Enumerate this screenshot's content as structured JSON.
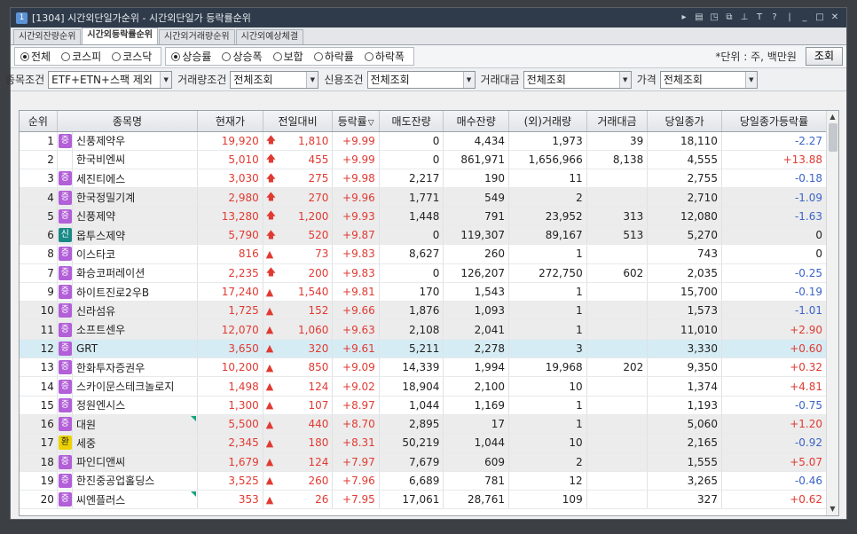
{
  "window": {
    "title": "[1304] 시간외단일가순위 - 시간외단일가 등락률순위",
    "icon_glyph": "1",
    "titlebar_icons": [
      "arrow-right-icon",
      "window-list-icon",
      "link-icon",
      "copy-icon",
      "pin-icon",
      "font-icon",
      "help-icon",
      "minimize-icon",
      "maximize-icon",
      "close-icon"
    ]
  },
  "tabs": [
    {
      "label": "시간외잔량순위",
      "active": false
    },
    {
      "label": "시간외등락률순위",
      "active": true
    },
    {
      "label": "시간외거래량순위",
      "active": false
    },
    {
      "label": "시간외예상체결",
      "active": false
    }
  ],
  "market_radios": [
    {
      "label": "전체",
      "selected": true
    },
    {
      "label": "코스피",
      "selected": false
    },
    {
      "label": "코스닥",
      "selected": false
    }
  ],
  "sort_radios": [
    {
      "label": "상승률",
      "selected": true
    },
    {
      "label": "상승폭",
      "selected": false
    },
    {
      "label": "보합",
      "selected": false
    },
    {
      "label": "하락률",
      "selected": false
    },
    {
      "label": "하락폭",
      "selected": false
    }
  ],
  "unit_text": "*단위 : 주, 백만원",
  "query_button": "조회",
  "filters": {
    "stock_cond_label": "종목조건",
    "stock_cond_value": "ETF+ETN+스팩 제외",
    "volume_cond_label": "거래량조건",
    "volume_cond_value": "전체조회",
    "credit_cond_label": "신용조건",
    "credit_cond_value": "전체조회",
    "amount_label": "거래대금",
    "amount_value": "전체조회",
    "price_label": "가격",
    "price_value": "전체조회"
  },
  "columns": [
    "순위",
    "종목명",
    "현재가",
    "전일대비",
    "등락률",
    "매도잔량",
    "매수잔량",
    "(외)거래량",
    "거래대금",
    "당일종가",
    "당일종가등락률"
  ],
  "sort_indicator": "▽",
  "rows": [
    {
      "rank": "1",
      "badge": "증",
      "badge_color": "#b25fd8",
      "name": "신풍제약우",
      "price": "19,920",
      "arrow": "🡅",
      "change": "1,810",
      "rate": "+9.99",
      "sell": "0",
      "buy": "4,434",
      "volume": "1,973",
      "amount": "39",
      "close": "18,110",
      "close_rate": "-2.27",
      "close_color": "blue",
      "shade": false,
      "hl": false,
      "tri": false
    },
    {
      "rank": "2",
      "badge": "",
      "badge_color": "",
      "name": "한국비엔씨",
      "price": "5,010",
      "arrow": "🡅",
      "change": "455",
      "rate": "+9.99",
      "sell": "0",
      "buy": "861,971",
      "volume": "1,656,966",
      "amount": "8,138",
      "close": "4,555",
      "close_rate": "+13.88",
      "close_color": "red",
      "shade": false,
      "hl": false,
      "tri": false
    },
    {
      "rank": "3",
      "badge": "증",
      "badge_color": "#b25fd8",
      "name": "세진티에스",
      "price": "3,030",
      "arrow": "🡅",
      "change": "275",
      "rate": "+9.98",
      "sell": "2,217",
      "buy": "190",
      "volume": "11",
      "amount": "",
      "close": "2,755",
      "close_rate": "-0.18",
      "close_color": "blue",
      "shade": false,
      "hl": false,
      "tri": false
    },
    {
      "rank": "4",
      "badge": "증",
      "badge_color": "#b25fd8",
      "name": "한국정밀기계",
      "price": "2,980",
      "arrow": "🡅",
      "change": "270",
      "rate": "+9.96",
      "sell": "1,771",
      "buy": "549",
      "volume": "2",
      "amount": "",
      "close": "2,710",
      "close_rate": "-1.09",
      "close_color": "blue",
      "shade": true,
      "hl": false,
      "tri": false
    },
    {
      "rank": "5",
      "badge": "증",
      "badge_color": "#b25fd8",
      "name": "신풍제약",
      "price": "13,280",
      "arrow": "🡅",
      "change": "1,200",
      "rate": "+9.93",
      "sell": "1,448",
      "buy": "791",
      "volume": "23,952",
      "amount": "313",
      "close": "12,080",
      "close_rate": "-1.63",
      "close_color": "blue",
      "shade": true,
      "hl": false,
      "tri": false
    },
    {
      "rank": "6",
      "badge": "신",
      "badge_color": "#1a8a86",
      "name": "옵투스제약",
      "price": "5,790",
      "arrow": "🡅",
      "change": "520",
      "rate": "+9.87",
      "sell": "0",
      "buy": "119,307",
      "volume": "89,167",
      "amount": "513",
      "close": "5,270",
      "close_rate": "0",
      "close_color": "black",
      "shade": true,
      "hl": false,
      "tri": false
    },
    {
      "rank": "8",
      "badge": "증",
      "badge_color": "#b25fd8",
      "name": "이스타코",
      "price": "816",
      "arrow": "▲",
      "change": "73",
      "rate": "+9.83",
      "sell": "8,627",
      "buy": "260",
      "volume": "1",
      "amount": "",
      "close": "743",
      "close_rate": "0",
      "close_color": "black",
      "shade": false,
      "hl": false,
      "tri": false
    },
    {
      "rank": "7",
      "badge": "증",
      "badge_color": "#b25fd8",
      "name": "화승코퍼레이션",
      "price": "2,235",
      "arrow": "🡅",
      "change": "200",
      "rate": "+9.83",
      "sell": "0",
      "buy": "126,207",
      "volume": "272,750",
      "amount": "602",
      "close": "2,035",
      "close_rate": "-0.25",
      "close_color": "blue",
      "shade": false,
      "hl": false,
      "tri": false
    },
    {
      "rank": "9",
      "badge": "증",
      "badge_color": "#b25fd8",
      "name": "하이트진로2우B",
      "price": "17,240",
      "arrow": "▲",
      "change": "1,540",
      "rate": "+9.81",
      "sell": "170",
      "buy": "1,543",
      "volume": "1",
      "amount": "",
      "close": "15,700",
      "close_rate": "-0.19",
      "close_color": "blue",
      "shade": false,
      "hl": false,
      "tri": false
    },
    {
      "rank": "10",
      "badge": "증",
      "badge_color": "#b25fd8",
      "name": "신라섬유",
      "price": "1,725",
      "arrow": "▲",
      "change": "152",
      "rate": "+9.66",
      "sell": "1,876",
      "buy": "1,093",
      "volume": "1",
      "amount": "",
      "close": "1,573",
      "close_rate": "-1.01",
      "close_color": "blue",
      "shade": true,
      "hl": false,
      "tri": false
    },
    {
      "rank": "11",
      "badge": "증",
      "badge_color": "#b25fd8",
      "name": "소프트센우",
      "price": "12,070",
      "arrow": "▲",
      "change": "1,060",
      "rate": "+9.63",
      "sell": "2,108",
      "buy": "2,041",
      "volume": "1",
      "amount": "",
      "close": "11,010",
      "close_rate": "+2.90",
      "close_color": "red",
      "shade": true,
      "hl": false,
      "tri": false
    },
    {
      "rank": "12",
      "badge": "증",
      "badge_color": "#b25fd8",
      "name": "GRT",
      "price": "3,650",
      "arrow": "▲",
      "change": "320",
      "rate": "+9.61",
      "sell": "5,211",
      "buy": "2,278",
      "volume": "3",
      "amount": "",
      "close": "3,330",
      "close_rate": "+0.60",
      "close_color": "red",
      "shade": false,
      "hl": true,
      "tri": false
    },
    {
      "rank": "13",
      "badge": "증",
      "badge_color": "#b25fd8",
      "name": "한화투자증권우",
      "price": "10,200",
      "arrow": "▲",
      "change": "850",
      "rate": "+9.09",
      "sell": "14,339",
      "buy": "1,994",
      "volume": "19,968",
      "amount": "202",
      "close": "9,350",
      "close_rate": "+0.32",
      "close_color": "red",
      "shade": false,
      "hl": false,
      "tri": false
    },
    {
      "rank": "14",
      "badge": "증",
      "badge_color": "#b25fd8",
      "name": "스카이문스테크놀로지",
      "price": "1,498",
      "arrow": "▲",
      "change": "124",
      "rate": "+9.02",
      "sell": "18,904",
      "buy": "2,100",
      "volume": "10",
      "amount": "",
      "close": "1,374",
      "close_rate": "+4.81",
      "close_color": "red",
      "shade": false,
      "hl": false,
      "tri": false
    },
    {
      "rank": "15",
      "badge": "증",
      "badge_color": "#b25fd8",
      "name": "정원엔시스",
      "price": "1,300",
      "arrow": "▲",
      "change": "107",
      "rate": "+8.97",
      "sell": "1,044",
      "buy": "1,169",
      "volume": "1",
      "amount": "",
      "close": "1,193",
      "close_rate": "-0.75",
      "close_color": "blue",
      "shade": false,
      "hl": false,
      "tri": false
    },
    {
      "rank": "16",
      "badge": "증",
      "badge_color": "#b25fd8",
      "name": "대원",
      "price": "5,500",
      "arrow": "▲",
      "change": "440",
      "rate": "+8.70",
      "sell": "2,895",
      "buy": "17",
      "volume": "1",
      "amount": "",
      "close": "5,060",
      "close_rate": "+1.20",
      "close_color": "red",
      "shade": true,
      "hl": false,
      "tri": true
    },
    {
      "rank": "17",
      "badge": "환",
      "badge_color": "#ecd200",
      "name": "세중",
      "price": "2,345",
      "arrow": "▲",
      "change": "180",
      "rate": "+8.31",
      "sell": "50,219",
      "buy": "1,044",
      "volume": "10",
      "amount": "",
      "close": "2,165",
      "close_rate": "-0.92",
      "close_color": "blue",
      "shade": true,
      "hl": false,
      "tri": false
    },
    {
      "rank": "18",
      "badge": "증",
      "badge_color": "#b25fd8",
      "name": "파인디앤씨",
      "price": "1,679",
      "arrow": "▲",
      "change": "124",
      "rate": "+7.97",
      "sell": "7,679",
      "buy": "609",
      "volume": "2",
      "amount": "",
      "close": "1,555",
      "close_rate": "+5.07",
      "close_color": "red",
      "shade": true,
      "hl": false,
      "tri": false
    },
    {
      "rank": "19",
      "badge": "증",
      "badge_color": "#b25fd8",
      "name": "한진중공업홀딩스",
      "price": "3,525",
      "arrow": "▲",
      "change": "260",
      "rate": "+7.96",
      "sell": "6,689",
      "buy": "781",
      "volume": "12",
      "amount": "",
      "close": "3,265",
      "close_rate": "-0.46",
      "close_color": "blue",
      "shade": false,
      "hl": false,
      "tri": false
    },
    {
      "rank": "20",
      "badge": "증",
      "badge_color": "#b25fd8",
      "name": "씨엔플러스",
      "price": "353",
      "arrow": "▲",
      "change": "26",
      "rate": "+7.95",
      "sell": "17,061",
      "buy": "28,761",
      "volume": "109",
      "amount": "",
      "close": "327",
      "close_rate": "+0.62",
      "close_color": "red",
      "shade": false,
      "hl": false,
      "tri": true
    }
  ]
}
